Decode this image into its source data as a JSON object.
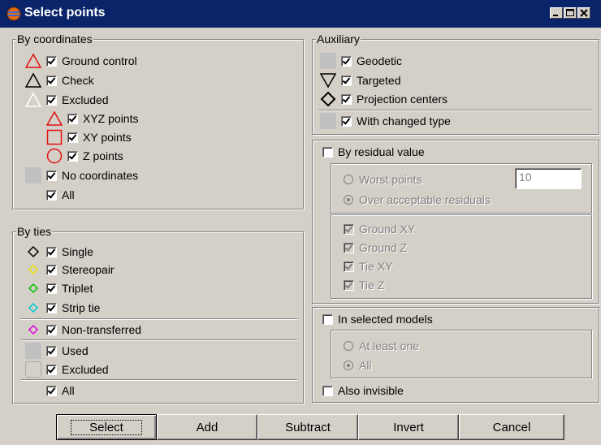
{
  "title": "Select points",
  "window_buttons": {
    "minimize": "_",
    "maximize": "□",
    "close": "×"
  },
  "by_coordinates": {
    "title": "By coordinates",
    "items": [
      {
        "label": "Ground control",
        "icon": "red-triangle-icon"
      },
      {
        "label": "Check",
        "icon": "black-triangle-icon"
      },
      {
        "label": "Excluded",
        "icon": "white-triangle-icon"
      },
      {
        "label": "XYZ points",
        "icon": "red-triangle-icon"
      },
      {
        "label": "XY points",
        "icon": "red-square-icon"
      },
      {
        "label": "Z points",
        "icon": "red-circle-icon"
      },
      {
        "label": "No coordinates",
        "icon": "gray-swatch-icon"
      },
      {
        "label": "All",
        "icon": ""
      }
    ]
  },
  "by_ties": {
    "title": "By ties",
    "items": [
      {
        "label": "Single",
        "icon": "black-diamond-icon"
      },
      {
        "label": "Stereopair",
        "icon": "yellow-diamond-icon"
      },
      {
        "label": "Triplet",
        "icon": "green-diamond-icon"
      },
      {
        "label": "Strip tie",
        "icon": "cyan-diamond-icon"
      },
      {
        "label": "Non-transferred",
        "icon": "magenta-diamond-icon"
      },
      {
        "label": "Used",
        "icon": "gray-swatch-icon"
      },
      {
        "label": "Excluded",
        "icon": "hollow-swatch-icon"
      },
      {
        "label": "All",
        "icon": ""
      }
    ]
  },
  "auxiliary": {
    "title": "Auxiliary",
    "items": [
      {
        "label": "Geodetic",
        "icon": "gray-swatch-icon"
      },
      {
        "label": "Targeted",
        "icon": "down-triangle-icon"
      },
      {
        "label": "Projection centers",
        "icon": "black-diamond-icon"
      },
      {
        "label": "With changed type",
        "icon": "gray-swatch-icon"
      }
    ]
  },
  "by_residual": {
    "label": "By residual value",
    "worst_points": "Worst points",
    "worst_points_value": "10",
    "over_acceptable": "Over acceptable residuals",
    "checks": [
      "Ground XY",
      "Ground Z",
      "Tie XY",
      "Tie Z"
    ]
  },
  "in_selected_models": {
    "label": "In selected models",
    "at_least_one": "At least one",
    "all": "All"
  },
  "also_invisible": "Also invisible",
  "buttons": {
    "select": "Select",
    "add": "Add",
    "subtract": "Subtract",
    "invert": "Invert",
    "cancel": "Cancel"
  },
  "colors": {
    "title_bar": "#0a246a",
    "dialog_bg": "#d4d0c8",
    "ground_control": "#e01010",
    "stereopair": "#e8e000",
    "triplet": "#00c000",
    "strip_tie": "#00c8d8",
    "non_transferred": "#e000e0"
  }
}
